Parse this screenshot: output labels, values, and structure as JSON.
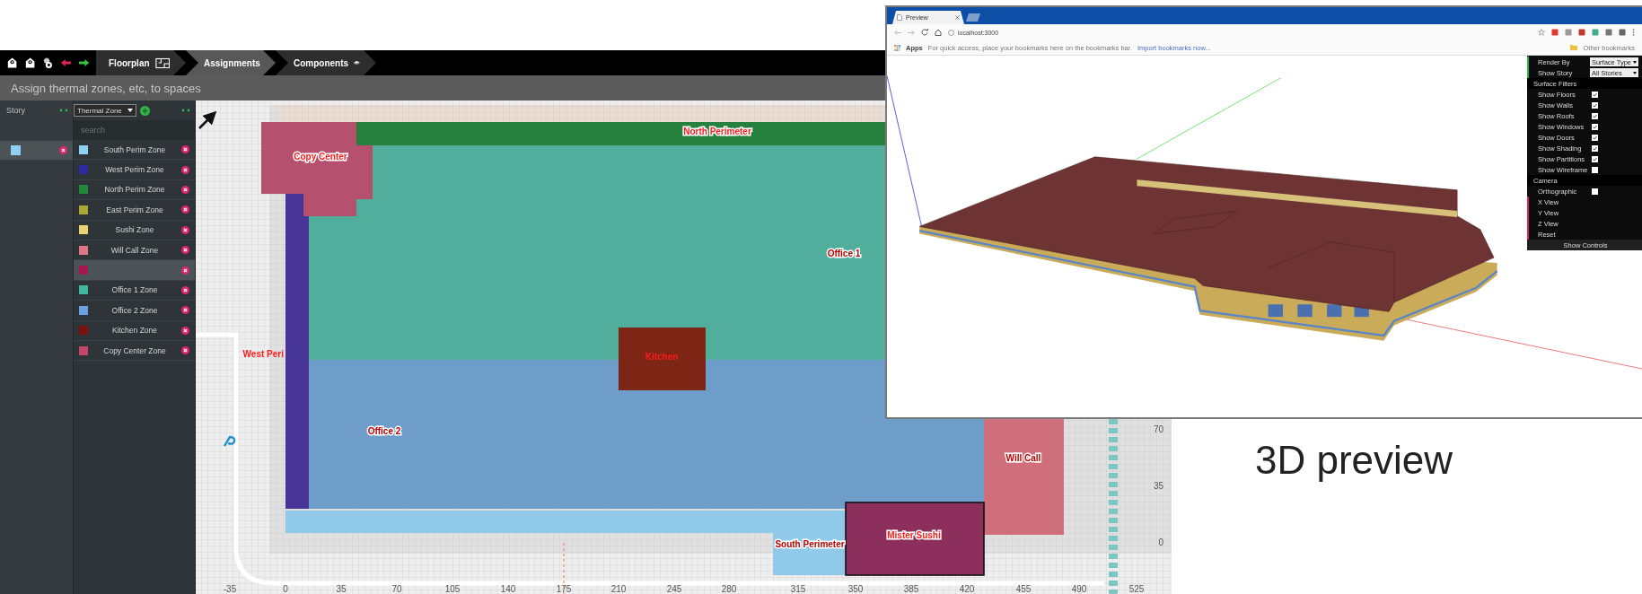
{
  "toolbar": {
    "tabs": [
      {
        "label": "Floorplan",
        "selected": false,
        "kind": "floorplan"
      },
      {
        "label": "Assignments",
        "selected": true,
        "kind": "link"
      },
      {
        "label": "Components",
        "selected": false,
        "kind": "cube"
      }
    ]
  },
  "instruction": "Assign thermal zones, etc, to spaces",
  "story_panel": {
    "title": "Story",
    "items": [
      {
        "color": "#8ed0f2",
        "selected": true
      }
    ]
  },
  "zone_panel": {
    "type_select": "Thermal Zone",
    "search": {
      "placeholder": "search"
    },
    "items": [
      {
        "name": "South Perim Zone",
        "color": "#8ed0f2",
        "selected": false
      },
      {
        "name": "West Perim Zone",
        "color": "#2c2a9e",
        "selected": false
      },
      {
        "name": "North Perim Zone",
        "color": "#1f8a3c",
        "selected": false
      },
      {
        "name": "East Perim Zone",
        "color": "#a8a832",
        "selected": false
      },
      {
        "name": "Sushi Zone",
        "color": "#e8d272",
        "selected": false
      },
      {
        "name": "Will Call Zone",
        "color": "#e07584",
        "selected": false
      },
      {
        "color": "#a3184f",
        "selected": true
      },
      {
        "name": "Office 1 Zone",
        "color": "#3fb7a0",
        "selected": false
      },
      {
        "name": "Office 2 Zone",
        "color": "#6a9fe0",
        "selected": false
      },
      {
        "name": "Kitchen Zone",
        "color": "#7a1010",
        "selected": false
      },
      {
        "name": "Copy Center Zone",
        "color": "#c2466a",
        "selected": false
      }
    ]
  },
  "floorplan": {
    "spaces": [
      {
        "label": "North Perimeter",
        "color": "#26813f"
      },
      {
        "label": "Copy Center",
        "color": "#b5506e"
      },
      {
        "label": "Office 1",
        "color": "#52ae9c"
      },
      {
        "label": "West Peri",
        "color": "#473497"
      },
      {
        "label": "Kitchen",
        "color": "#7e2616"
      },
      {
        "label": "Office 2",
        "color": "#6f9dc9"
      },
      {
        "label": "South Perimeter",
        "color": "#90c9ea"
      },
      {
        "label": "Mister Sushi",
        "color": "#8c2f5c"
      },
      {
        "label": "Will Call",
        "color": "#d06f7c"
      }
    ],
    "x_ticks": [
      "-35",
      "0",
      "35",
      "70",
      "105",
      "140",
      "175",
      "210",
      "245",
      "280",
      "315",
      "350",
      "385",
      "420",
      "455",
      "490",
      "525"
    ],
    "y_ticks": [
      "70",
      "35",
      "0"
    ]
  },
  "preview": {
    "tab_title": "Preview",
    "url": "localhost:3000",
    "bookmarks_bar": {
      "apps": "Apps",
      "hint": "For quick access, place your bookmarks here on the bookmarks bar.",
      "import_link": "Import bookmarks now...",
      "other": "Other bookmarks"
    },
    "controls": [
      {
        "kind": "select",
        "label": "Render By",
        "value": "Surface Type"
      },
      {
        "kind": "select",
        "label": "Show Story",
        "value": "All Stories"
      },
      {
        "kind": "section",
        "label": "Surface Filters"
      },
      {
        "kind": "checkbox",
        "label": "Show Floors",
        "checked": true
      },
      {
        "kind": "checkbox",
        "label": "Show Walls",
        "checked": true
      },
      {
        "kind": "checkbox",
        "label": "Show Roofs",
        "checked": true
      },
      {
        "kind": "checkbox",
        "label": "Show Windows",
        "checked": true
      },
      {
        "kind": "checkbox",
        "label": "Show Doors",
        "checked": true
      },
      {
        "kind": "checkbox",
        "label": "Show Shading",
        "checked": true
      },
      {
        "kind": "checkbox",
        "label": "Show Partitions",
        "checked": true
      },
      {
        "kind": "checkbox",
        "label": "Show Wireframe",
        "checked": false
      },
      {
        "kind": "section",
        "label": "Camera"
      },
      {
        "kind": "checkbox",
        "label": "Orthographic",
        "checked": false
      },
      {
        "kind": "button",
        "label": "X View"
      },
      {
        "kind": "button",
        "label": "Y View"
      },
      {
        "kind": "button",
        "label": "Z View"
      },
      {
        "kind": "button",
        "label": "Reset"
      },
      {
        "kind": "footer",
        "label": "Show Controls"
      }
    ]
  },
  "caption": "3D preview"
}
